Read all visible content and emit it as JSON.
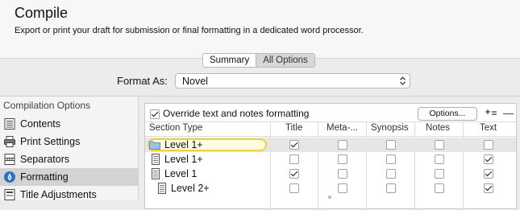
{
  "header": {
    "title": "Compile",
    "subtitle": "Export or print your draft for submission or final formatting in a dedicated word processor."
  },
  "tabs": [
    {
      "label": "Summary",
      "active": true
    },
    {
      "label": "All Options",
      "active": false
    }
  ],
  "format": {
    "label": "Format As:",
    "value": "Novel"
  },
  "sidebar": {
    "heading": "Compilation Options",
    "items": [
      {
        "label": "Contents",
        "icon": "contents-list-icon",
        "selected": false
      },
      {
        "label": "Print Settings",
        "icon": "printer-icon",
        "selected": false
      },
      {
        "label": "Separators",
        "icon": "separators-icon",
        "selected": false
      },
      {
        "label": "Formatting",
        "icon": "formatting-pen-icon",
        "selected": true
      },
      {
        "label": "Title Adjustments",
        "icon": "title-adjustments-icon",
        "selected": false
      }
    ]
  },
  "panel": {
    "override_label": "Override text and notes formatting",
    "override_checked": true,
    "options_button": "Options...",
    "add_icon": "add-level-icon",
    "remove_icon": "remove-level-icon",
    "columns": [
      "Section Type",
      "Title",
      "Meta-...",
      "Synopsis",
      "Notes",
      "Text"
    ],
    "rows": [
      {
        "label": "Level  1+",
        "icon": "folder-icon",
        "selected": true,
        "editing": true,
        "checks": [
          true,
          false,
          false,
          false,
          false
        ]
      },
      {
        "label": "Level  1+",
        "icon": "document-icon",
        "selected": false,
        "editing": false,
        "checks": [
          false,
          false,
          false,
          false,
          true
        ]
      },
      {
        "label": "Level  1",
        "icon": "document-icon",
        "selected": false,
        "editing": false,
        "checks": [
          true,
          false,
          false,
          false,
          true
        ]
      },
      {
        "label": "Level  2+",
        "icon": "document-icon",
        "selected": false,
        "editing": false,
        "checks": [
          false,
          false,
          false,
          false,
          true
        ]
      }
    ]
  },
  "colors": {
    "selection": "#d3d3d3",
    "edit_highlight": "#f0d040"
  }
}
